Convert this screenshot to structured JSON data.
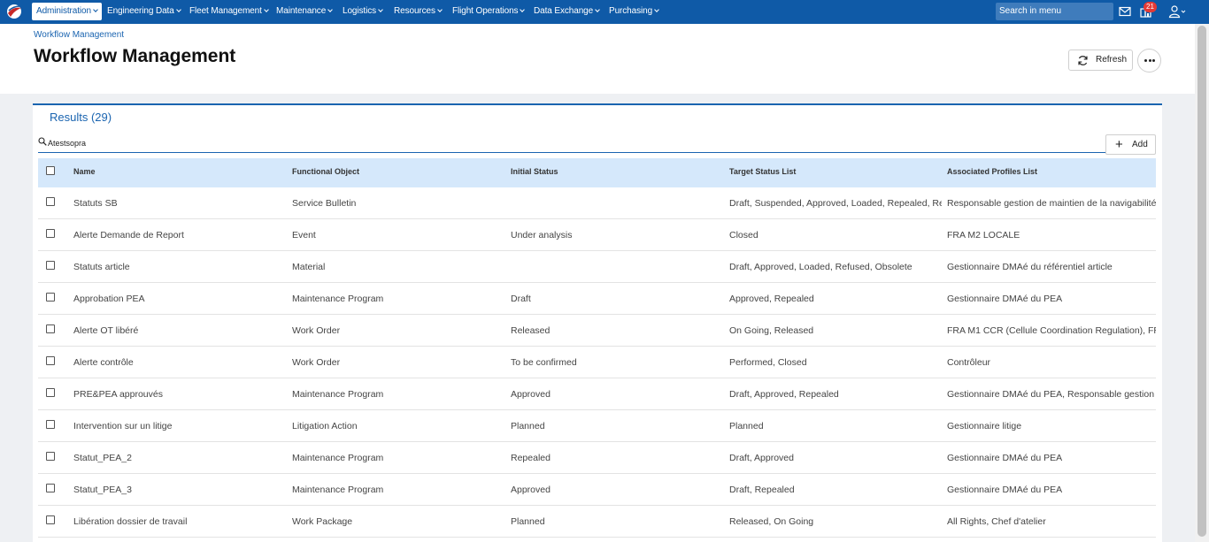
{
  "nav": {
    "items": [
      {
        "label": "Administration",
        "active": true
      },
      {
        "label": "Engineering Data"
      },
      {
        "label": "Fleet Management"
      },
      {
        "label": "Maintenance"
      },
      {
        "label": "Logistics"
      },
      {
        "label": "Resources"
      },
      {
        "label": "Flight Operations"
      },
      {
        "label": "Data Exchange"
      },
      {
        "label": "Purchasing"
      }
    ],
    "search_placeholder": "Search in menu",
    "notification_count": "21",
    "icons": [
      "app-logo-icon",
      "mail-icon",
      "notification-icon",
      "user-icon"
    ]
  },
  "header": {
    "breadcrumb": "Workflow Management",
    "title": "Workflow Management",
    "refresh_label": "Refresh"
  },
  "results": {
    "title": "Results (29)",
    "search_value": "Atestsopra",
    "add_label": "Add"
  },
  "table": {
    "columns": [
      "Name",
      "Functional Object",
      "Initial Status",
      "Target Status List",
      "Associated Profiles List"
    ],
    "rows": [
      [
        "Statuts SB",
        "Service Bulletin",
        "",
        "Draft, Suspended, Approved, Loaded, Repealed, Re",
        "Responsable gestion de maintien de la navigabilité"
      ],
      [
        "Alerte Demande de Report",
        "Event",
        "Under analysis",
        "Closed",
        "FRA M2 LOCALE"
      ],
      [
        "Statuts article",
        "Material",
        "",
        "Draft, Approved, Loaded, Refused, Obsolete",
        "Gestionnaire DMAé du référentiel article"
      ],
      [
        "Approbation PEA",
        "Maintenance Program",
        "Draft",
        "Approved, Repealed",
        "Gestionnaire DMAé du PEA"
      ],
      [
        "Alerte OT libéré",
        "Work Order",
        "Released",
        "On Going, Released",
        "FRA M1 CCR (Cellule Coordination Regulation), FR..."
      ],
      [
        "Alerte contrôle",
        "Work Order",
        "To be confirmed",
        "Performed, Closed",
        "Contrôleur"
      ],
      [
        "PRE&PEA approuvés",
        "Maintenance Program",
        "Approved",
        "Draft, Approved, Repealed",
        "Gestionnaire DMAé du PEA, Responsable gestion d"
      ],
      [
        "Intervention sur un litige",
        "Litigation Action",
        "Planned",
        "Planned",
        "Gestionnaire litige"
      ],
      [
        "Statut_PEA_2",
        "Maintenance Program",
        "Repealed",
        "Draft, Approved",
        "Gestionnaire DMAé du PEA"
      ],
      [
        "Statut_PEA_3",
        "Maintenance Program",
        "Approved",
        "Draft, Repealed",
        "Gestionnaire DMAé du PEA"
      ],
      [
        "Libération dossier de travail",
        "Work Package",
        "Planned",
        "Released, On Going",
        "All Rights, Chef d'atelier"
      ]
    ]
  },
  "colors": {
    "brand": "#0f5aa7",
    "header_row": "#d5e8fb",
    "badge": "#e53935"
  }
}
